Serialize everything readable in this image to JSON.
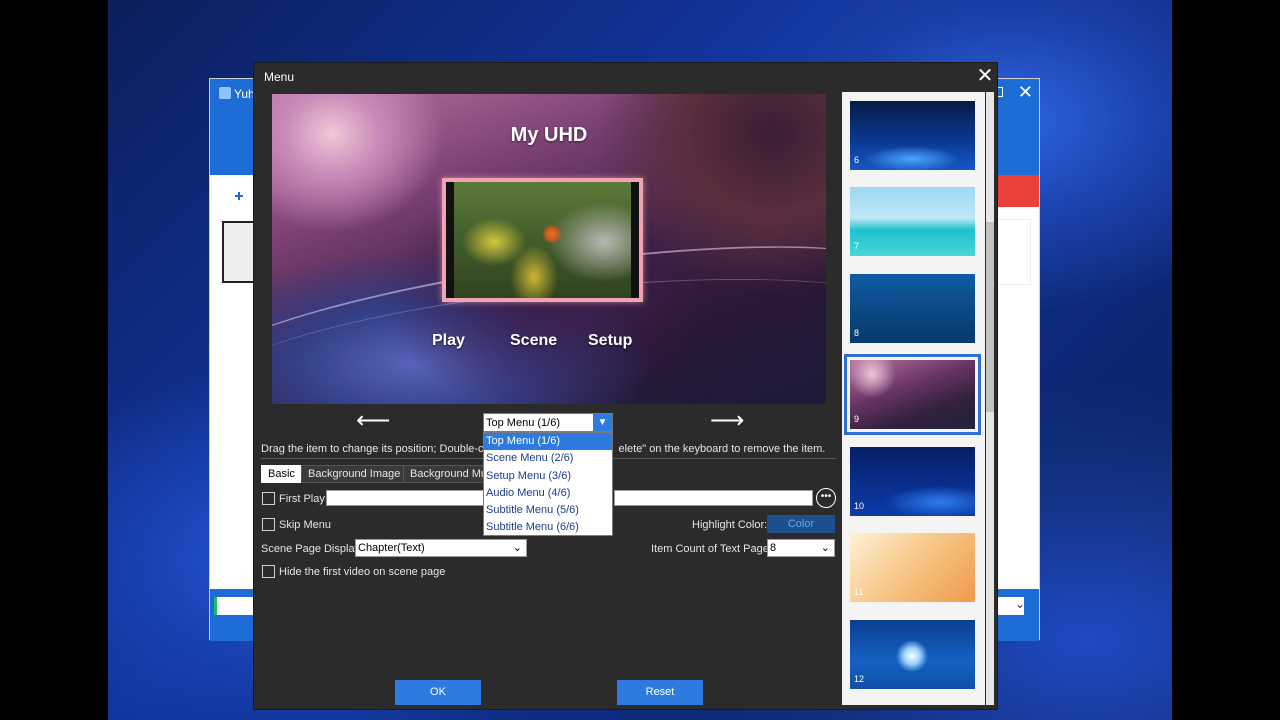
{
  "background_app": {
    "title": "Yuh"
  },
  "dialog": {
    "title": "Menu",
    "close_glyph": "✕"
  },
  "preview": {
    "menu_title": "My UHD",
    "buttons": [
      "Play",
      "Scene",
      "Setup"
    ]
  },
  "navigation": {
    "prev_glyph": "⟵",
    "next_glyph": "⟶"
  },
  "menu_select": {
    "value": "Top Menu (1/6)",
    "options": [
      "Top Menu (1/6)",
      "Scene Menu (2/6)",
      "Setup Menu (3/6)",
      "Audio Menu (4/6)",
      "Subtitle Menu (5/6)",
      "Subtitle Menu (6/6)"
    ],
    "selected_index": 0
  },
  "hint": {
    "left": "Drag the item to change its position; Double-cli",
    "right": "elete\" on the keyboard to remove the item."
  },
  "tabs": [
    "Basic",
    "Background Image",
    "Background Mu"
  ],
  "form": {
    "first_play_label": "First Play:",
    "first_play_value": "",
    "skip_menu_label": "Skip Menu",
    "highlight_color_label": "Highlight Color:",
    "color_button": "Color",
    "scene_page_display_label": "Scene Page Display:",
    "scene_page_display_value": "Chapter(Text)",
    "item_count_label": "Item Count of Text Page:",
    "item_count_value": "8",
    "hide_first_video_label": "Hide the first video on scene page"
  },
  "buttons": {
    "ok": "OK",
    "reset": "Reset"
  },
  "templates": [
    {
      "number": "6",
      "selected": false
    },
    {
      "number": "7",
      "selected": false
    },
    {
      "number": "8",
      "selected": false
    },
    {
      "number": "9",
      "selected": true
    },
    {
      "number": "10",
      "selected": false
    },
    {
      "number": "11",
      "selected": false
    },
    {
      "number": "12",
      "selected": false
    }
  ],
  "colors": {
    "accent": "#2d7be0",
    "dialog_bg": "#2b2b2b",
    "selected_outline": "#2d6fd6"
  }
}
